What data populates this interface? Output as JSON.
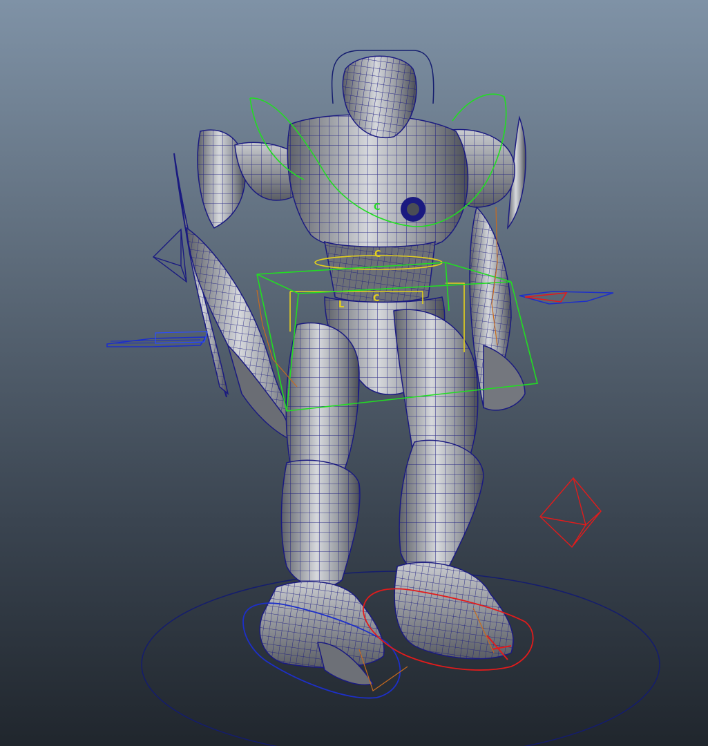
{
  "viewport": {
    "name": "3d-viewport",
    "background_top": "#7f92a6",
    "background_bottom": "#20262d"
  },
  "colors": {
    "wireframe": "#1a1a80",
    "mesh_fill": "#8c8f94",
    "mesh_highlight": "#d9dbde",
    "control_green": "#22dd22",
    "control_yellow": "#e6d21a",
    "control_red": "#e21b1b",
    "control_blue": "#1d2fc9",
    "ground_circle": "#141c6e",
    "joint_orange": "#c86a1e"
  },
  "controls": {
    "chest_label": "C",
    "waist_label": "C",
    "hip_label": "C",
    "hip_small_label": "L"
  },
  "model": {
    "name": "robot-mech",
    "display_mode": "wireframe-on-shaded"
  }
}
